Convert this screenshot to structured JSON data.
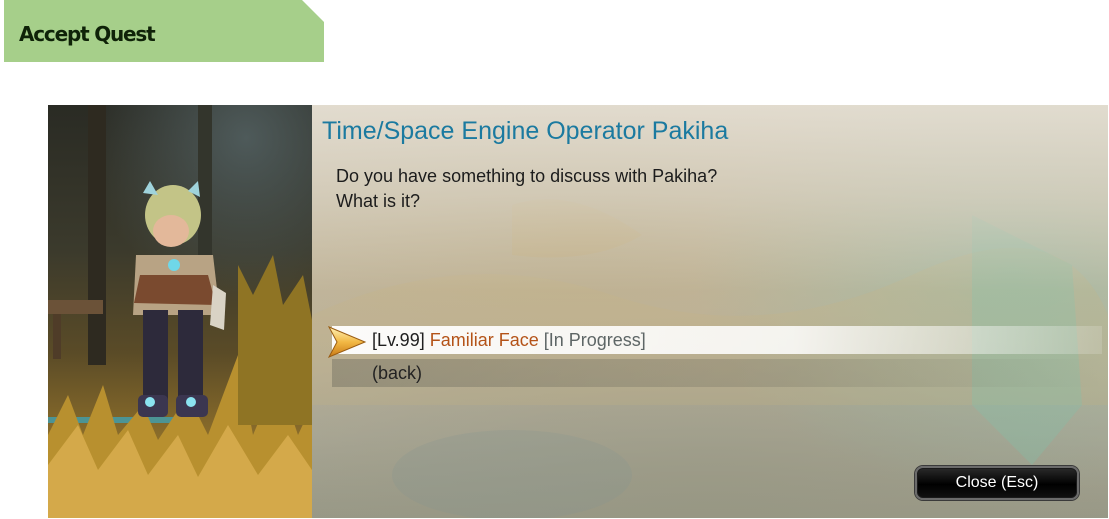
{
  "tag": {
    "label": "Accept Quest"
  },
  "dialog": {
    "npc_name": "Time/Space Engine Operator Pakiha",
    "greeting_lines": [
      "Do you have something to discuss with Pakiha?",
      "What is it?"
    ],
    "options": [
      {
        "level": "[Lv.99]",
        "name": "Familiar Face",
        "status": "[In Progress]"
      },
      {
        "label": "(back)"
      }
    ],
    "close_button": "Close (Esc)"
  },
  "colors": {
    "tag_bg": "#a6cf8a",
    "npc_name": "#1b7aa0",
    "quest_name": "#b45318",
    "quest_status": "#5e6666"
  }
}
